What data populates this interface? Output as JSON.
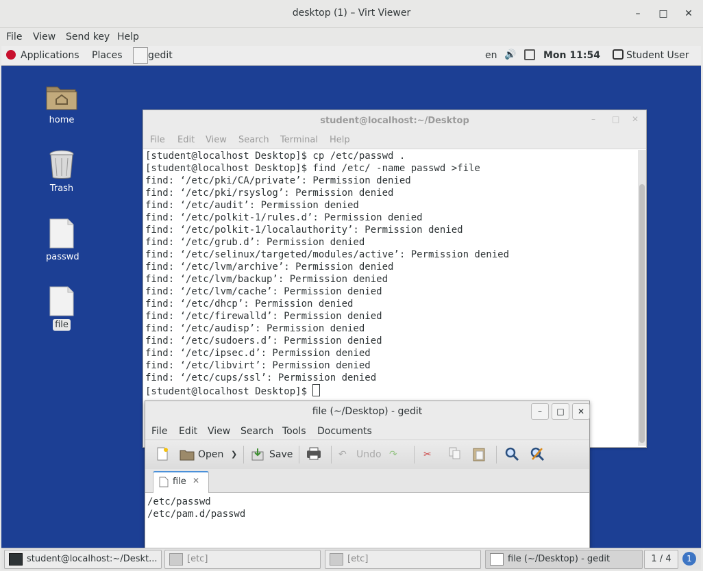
{
  "window": {
    "title": "desktop (1) – Virt Viewer"
  },
  "viewer_menu": [
    "File",
    "View",
    "Send key",
    "Help"
  ],
  "guest_topbar": {
    "applications": "Applications",
    "places": "Places",
    "active_app": "gedit",
    "language": "en",
    "clock": "Mon 11:54",
    "user": "Student User"
  },
  "desktop_icons": [
    {
      "label": "home",
      "icon": "home-folder-icon"
    },
    {
      "label": "Trash",
      "icon": "trash-icon"
    },
    {
      "label": "passwd",
      "icon": "file-icon"
    },
    {
      "label": "file",
      "icon": "file-icon"
    }
  ],
  "terminal": {
    "title": "student@localhost:~/Desktop",
    "menu": [
      "File",
      "Edit",
      "View",
      "Search",
      "Terminal",
      "Help"
    ],
    "lines": [
      "[student@localhost Desktop]$ cp /etc/passwd .",
      "[student@localhost Desktop]$ find /etc/ -name passwd >file",
      "find: ‘/etc/pki/CA/private’: Permission denied",
      "find: ‘/etc/pki/rsyslog’: Permission denied",
      "find: ‘/etc/audit’: Permission denied",
      "find: ‘/etc/polkit-1/rules.d’: Permission denied",
      "find: ‘/etc/polkit-1/localauthority’: Permission denied",
      "find: ‘/etc/grub.d’: Permission denied",
      "find: ‘/etc/selinux/targeted/modules/active’: Permission denied",
      "find: ‘/etc/lvm/archive’: Permission denied",
      "find: ‘/etc/lvm/backup’: Permission denied",
      "find: ‘/etc/lvm/cache’: Permission denied",
      "find: ‘/etc/dhcp’: Permission denied",
      "find: ‘/etc/firewalld’: Permission denied",
      "find: ‘/etc/audisp’: Permission denied",
      "find: ‘/etc/sudoers.d’: Permission denied",
      "find: ‘/etc/ipsec.d’: Permission denied",
      "find: ‘/etc/libvirt’: Permission denied",
      "find: ‘/etc/cups/ssl’: Permission denied"
    ],
    "prompt": "[student@localhost Desktop]$ "
  },
  "gedit": {
    "title": "file (~/Desktop) - gedit",
    "menu": [
      "File",
      "Edit",
      "View",
      "Search",
      "Tools",
      "Documents"
    ],
    "toolbar": {
      "open": "Open",
      "save": "Save",
      "undo": "Undo"
    },
    "tab_label": "file",
    "content": [
      "/etc/passwd",
      "/etc/pam.d/passwd"
    ]
  },
  "taskbar": {
    "items": [
      {
        "label": "student@localhost:~/Deskt...",
        "icon": "terminal-icon"
      },
      {
        "label": "[etc]",
        "icon": "file-manager-icon"
      },
      {
        "label": "[etc]",
        "icon": "file-manager-icon"
      },
      {
        "label": "file (~/Desktop) - gedit",
        "icon": "text-editor-icon"
      }
    ],
    "workspace": "1 / 4",
    "notification_count": "1"
  }
}
